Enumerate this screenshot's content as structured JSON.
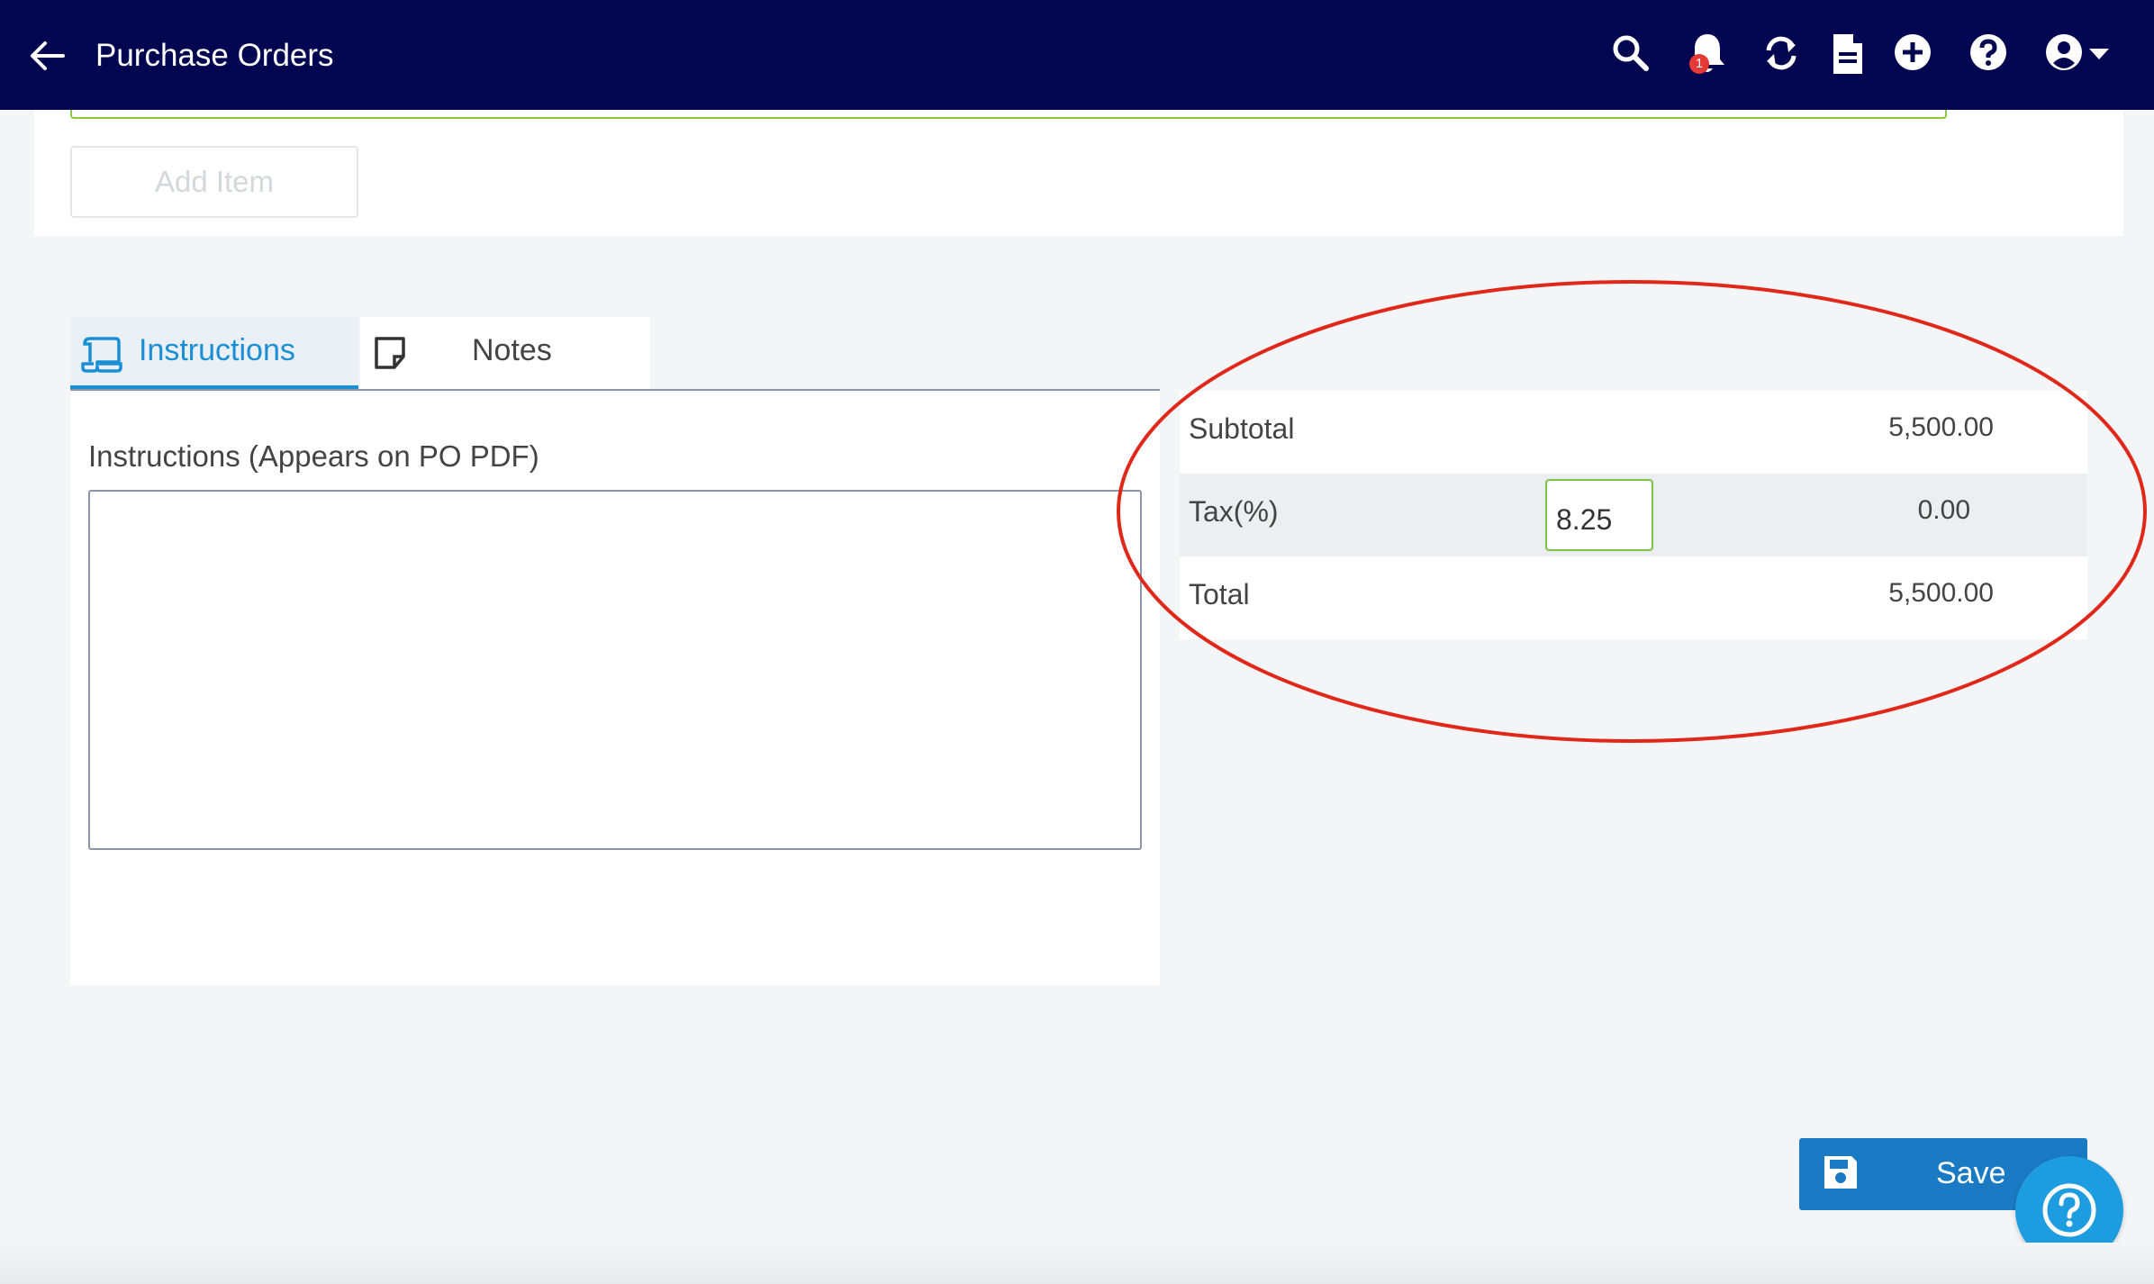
{
  "header": {
    "title": "Purchase Orders",
    "notification_count": "1",
    "icons": [
      "back-arrow-icon",
      "search-icon",
      "bell-icon",
      "sync-icon",
      "document-icon",
      "add-circle-icon",
      "help-circle-icon",
      "user-account-icon",
      "caret-down-icon"
    ]
  },
  "items": {
    "add_item_label": "Add Item"
  },
  "tabs": [
    {
      "label": "Instructions",
      "icon": "scroll-icon",
      "active": true
    },
    {
      "label": "Notes",
      "icon": "sticky-note-icon",
      "active": false
    }
  ],
  "instructions": {
    "field_label": "Instructions (Appears on PO PDF)",
    "value": ""
  },
  "totals": {
    "subtotal_label": "Subtotal",
    "subtotal_value": "5,500.00",
    "tax_label": "Tax(%)",
    "tax_rate": "8.25",
    "tax_value": "0.00",
    "total_label": "Total",
    "total_value": "5,500.00"
  },
  "actions": {
    "save_label": "Save"
  },
  "colors": {
    "header_bg": "#020650",
    "accent_blue": "#1a8fd3",
    "save_blue": "#1a7bc4",
    "input_green": "#7dc540",
    "annotation_red": "#e0281a"
  }
}
